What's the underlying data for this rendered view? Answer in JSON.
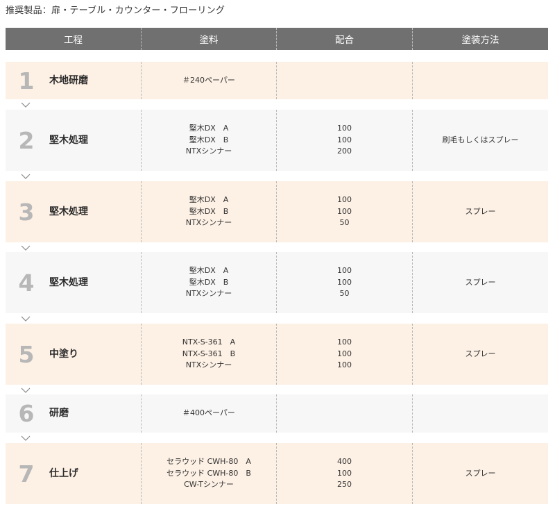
{
  "intro": "推奨製品：扉・テーブル・カウンター・フローリング",
  "headers": [
    "工程",
    "塗料",
    "配合",
    "塗装方法"
  ],
  "steps": [
    {
      "num": "1",
      "name": "木地研磨",
      "paints": [
        "＃240ペーパー"
      ],
      "ratios": [],
      "method": ""
    },
    {
      "num": "2",
      "name": "堅木処理",
      "paints": [
        "堅木DX　A",
        "堅木DX　B",
        "NTXシンナー"
      ],
      "ratios": [
        "100",
        "100",
        "200"
      ],
      "method": "刷毛もしくはスプレー"
    },
    {
      "num": "3",
      "name": "堅木処理",
      "paints": [
        "堅木DX　A",
        "堅木DX　B",
        "NTXシンナー"
      ],
      "ratios": [
        "100",
        "100",
        "50"
      ],
      "method": "スプレー"
    },
    {
      "num": "4",
      "name": "堅木処理",
      "paints": [
        "堅木DX　A",
        "堅木DX　B",
        "NTXシンナー"
      ],
      "ratios": [
        "100",
        "100",
        "50"
      ],
      "method": "スプレー"
    },
    {
      "num": "5",
      "name": "中塗り",
      "paints": [
        "NTX-S-361　A",
        "NTX-S-361　B",
        "NTXシンナー"
      ],
      "ratios": [
        "100",
        "100",
        "100"
      ],
      "method": "スプレー"
    },
    {
      "num": "6",
      "name": "研磨",
      "paints": [
        "＃400ペーパー"
      ],
      "ratios": [],
      "method": ""
    },
    {
      "num": "7",
      "name": "仕上げ",
      "paints": [
        "セラウッド CWH-80　A",
        "セラウッド CWH-80　B",
        "CW-Tシンナー"
      ],
      "ratios": [
        "400",
        "100",
        "250"
      ],
      "method": "スプレー"
    }
  ]
}
